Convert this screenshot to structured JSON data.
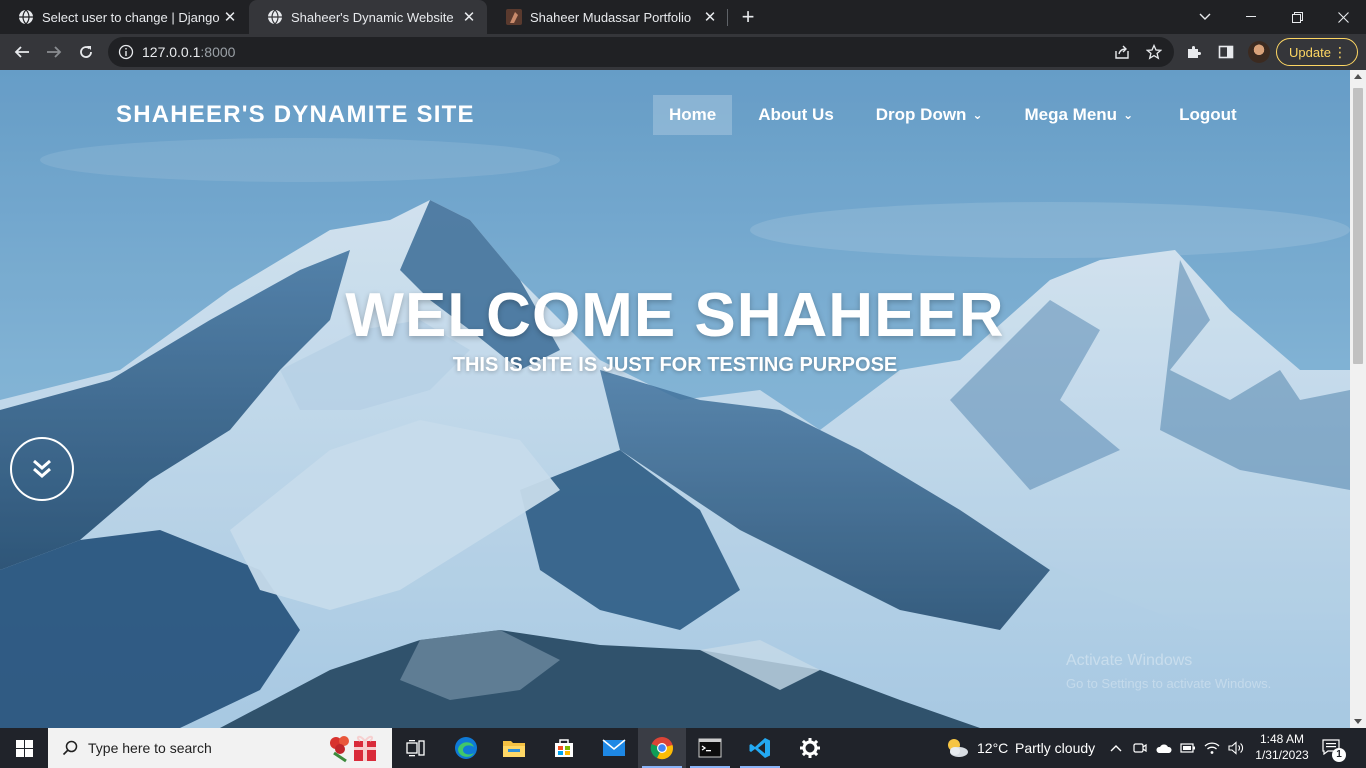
{
  "browser": {
    "tabs": [
      {
        "title": "Select user to change | Django site admin",
        "active": false
      },
      {
        "title": "Shaheer's Dynamic Website",
        "active": true
      },
      {
        "title": "Shaheer Mudassar Portfolio",
        "active": false
      }
    ],
    "url_host": "127.0.0.1",
    "url_port": ":8000",
    "update_label": "Update"
  },
  "site": {
    "brand": "SHAHEER'S DYNAMITE SITE",
    "nav": [
      {
        "label": "Home",
        "active": true,
        "dropdown": false
      },
      {
        "label": "About Us",
        "active": false,
        "dropdown": false
      },
      {
        "label": "Drop Down",
        "active": false,
        "dropdown": true
      },
      {
        "label": "Mega Menu",
        "active": false,
        "dropdown": true
      },
      {
        "label": "Logout",
        "active": false,
        "dropdown": false
      }
    ],
    "hero_title": "WELCOME SHAHEER",
    "hero_subtitle": "THIS IS SITE IS JUST FOR TESTING PURPOSE",
    "watermark_line1": "Activate Windows",
    "watermark_line2": "Go to Settings to activate Windows."
  },
  "taskbar": {
    "search_placeholder": "Type here to search",
    "weather_temp": "12°C",
    "weather_desc": "Partly cloudy",
    "time": "1:48 AM",
    "date": "1/31/2023",
    "notifications": "1",
    "pinned_apps": [
      "task-view",
      "edge",
      "file-explorer",
      "microsoft-store",
      "mail",
      "chrome",
      "terminal",
      "vscode",
      "settings"
    ]
  },
  "colors": {
    "chrome_dark": "#202124",
    "chrome_toolbar": "#35363a",
    "update_accent": "#fdd663",
    "sky": "#6ea3cc",
    "mountain_shadow": "#2f5d86",
    "taskbar": "#20232a"
  }
}
